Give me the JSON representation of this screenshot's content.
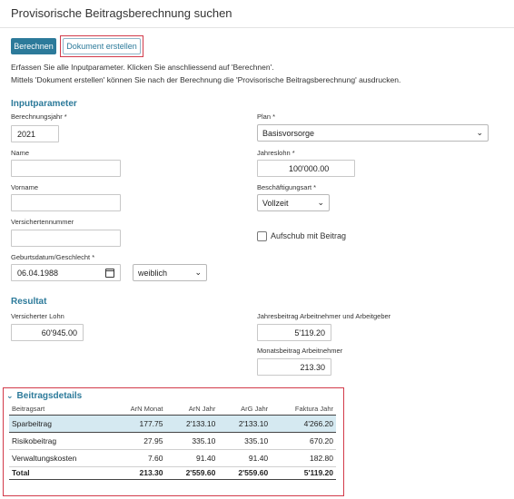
{
  "page": {
    "title": "Provisorische Beitragsberechnung suchen"
  },
  "toolbar": {
    "calculate_label": "Berechnen",
    "create_doc_label": "Dokument erstellen"
  },
  "info": {
    "line1": "Erfassen Sie alle Inputparameter. Klicken Sie anschliessend auf 'Berechnen'.",
    "line2": "Mittels 'Dokument erstellen' können Sie nach der Berechnung die 'Provisorische Beitragsberechnung' ausdrucken."
  },
  "input": {
    "section_title": "Inputparameter",
    "year": {
      "label": "Berechnungsjahr *",
      "value": "2021"
    },
    "plan": {
      "label": "Plan *",
      "value": "Basisvorsorge"
    },
    "name": {
      "label": "Name",
      "value": ""
    },
    "salary": {
      "label": "Jahreslohn *",
      "value": "100'000.00"
    },
    "firstname": {
      "label": "Vorname",
      "value": ""
    },
    "employment": {
      "label": "Beschäftigungsart *",
      "value": "Vollzeit"
    },
    "insured_no": {
      "label": "Versichertennummer",
      "value": ""
    },
    "deferral": {
      "label": "Aufschub mit Beitrag",
      "checked": false
    },
    "birth": {
      "label": "Geburtsdatum/Geschlecht *",
      "date": "06.04.1988",
      "gender": "weiblich"
    }
  },
  "result": {
    "section_title": "Resultat",
    "insured_salary": {
      "label": "Versicherter Lohn",
      "value": "60'945.00"
    },
    "annual_contribution": {
      "label": "Jahresbeitrag Arbeitnehmer und Arbeitgeber",
      "value": "5'119.20"
    },
    "monthly_contribution": {
      "label": "Monatsbeitrag Arbeitnehmer",
      "value": "213.30"
    }
  },
  "details": {
    "section_title": "Beitragsdetails",
    "headers": [
      "Beitragsart",
      "ArN Monat",
      "ArN Jahr",
      "ArG Jahr",
      "Faktura Jahr"
    ],
    "rows": [
      [
        "Sparbeitrag",
        "177.75",
        "2'133.10",
        "2'133.10",
        "4'266.20"
      ],
      [
        "Risikobeitrag",
        "27.95",
        "335.10",
        "335.10",
        "670.20"
      ],
      [
        "Verwaltungskosten",
        "7.60",
        "91.40",
        "91.40",
        "182.80"
      ]
    ],
    "total": [
      "Total",
      "213.30",
      "2'559.60",
      "2'559.60",
      "5'119.20"
    ]
  },
  "colors": {
    "accent": "#2c7a9a",
    "highlight_border": "#d23a4a",
    "selected_row": "#d5e9f1"
  },
  "icons": {
    "calendar": "calendar-icon",
    "dropdown": "chevron-down-icon",
    "collapse": "chevron-down-icon"
  }
}
